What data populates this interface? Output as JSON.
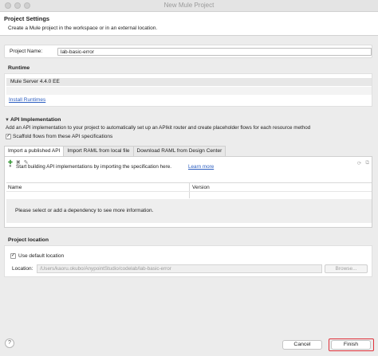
{
  "window": {
    "title": "New Mule Project"
  },
  "header": {
    "title": "Project Settings",
    "subtitle": "Create a Mule project in the workspace or in an external location."
  },
  "project_name": {
    "label": "Project Name:",
    "value": "lab-basic-error"
  },
  "runtime": {
    "title": "Runtime",
    "selected": "Mule Server 4.4.0 EE",
    "install_link": "Install Runtimes"
  },
  "api": {
    "title": "API Implementation",
    "description": "Add an API implementation to your project to automatically set up an APIkit router and create placeholder flows for each resource method",
    "scaffold_label": "Scaffold flows from these API specifications",
    "scaffold_checked": true,
    "tabs": [
      {
        "label": "Import a published API",
        "active": true
      },
      {
        "label": "Import RAML from local file",
        "active": false
      },
      {
        "label": "Download RAML from Design Center",
        "active": false
      }
    ],
    "info_text": "Start building API implementations by importing the specification here.",
    "learn_more": "Learn more",
    "table": {
      "columns": [
        "Name",
        "Version"
      ]
    },
    "empty_message": "Please select or add a dependency to see more information."
  },
  "location": {
    "title": "Project location",
    "default_label": "Use default location",
    "default_checked": true,
    "location_label": "Location:",
    "location_value": "/Users/kaoru.okubo/AnypointStudio/codelab/lab-basic-error",
    "browse_label": "Browse..."
  },
  "footer": {
    "help": "?",
    "cancel_label": "Cancel",
    "finish_label": "Finish"
  },
  "colors": {
    "link": "#2b5dc0",
    "highlight": "#e0313a",
    "add_icon": "#3a9a3a"
  },
  "icons": [
    "add-icon",
    "remove-icon",
    "edit-icon",
    "info-icon",
    "refresh-icon",
    "collapse-icon",
    "chevron-down-icon",
    "help-icon"
  ]
}
